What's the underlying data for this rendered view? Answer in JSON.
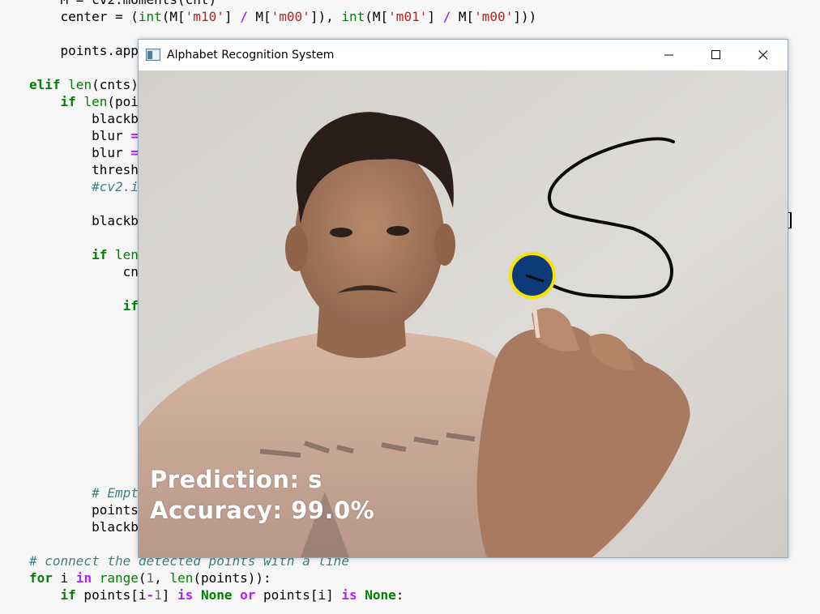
{
  "code_lines": [
    {
      "indent": "    ",
      "parts": [
        {
          "t": "M = cv2.moments(cnt)",
          "c": ""
        }
      ]
    },
    {
      "indent": "    ",
      "parts": [
        {
          "t": "center = (",
          "c": ""
        },
        {
          "t": "int",
          "c": "bi"
        },
        {
          "t": "(M[",
          "c": ""
        },
        {
          "t": "'m10'",
          "c": "str"
        },
        {
          "t": "] ",
          "c": ""
        },
        {
          "t": "/",
          "c": "op"
        },
        {
          "t": " M[",
          "c": ""
        },
        {
          "t": "'m00'",
          "c": "str"
        },
        {
          "t": "]), ",
          "c": ""
        },
        {
          "t": "int",
          "c": "bi"
        },
        {
          "t": "(M[",
          "c": ""
        },
        {
          "t": "'m01'",
          "c": "str"
        },
        {
          "t": "] ",
          "c": ""
        },
        {
          "t": "/",
          "c": "op"
        },
        {
          "t": " M[",
          "c": ""
        },
        {
          "t": "'m00'",
          "c": "str"
        },
        {
          "t": "]))",
          "c": ""
        }
      ]
    },
    {
      "indent": "",
      "parts": []
    },
    {
      "indent": "    ",
      "parts": [
        {
          "t": "points.app",
          "c": ""
        }
      ]
    },
    {
      "indent": "",
      "parts": []
    },
    {
      "indent": "",
      "parts": [
        {
          "t": "elif",
          "c": "kw"
        },
        {
          "t": " ",
          "c": ""
        },
        {
          "t": "len",
          "c": "bi"
        },
        {
          "t": "(cnts)",
          "c": ""
        }
      ]
    },
    {
      "indent": "    ",
      "parts": [
        {
          "t": "if",
          "c": "kw"
        },
        {
          "t": " ",
          "c": ""
        },
        {
          "t": "len",
          "c": "bi"
        },
        {
          "t": "(poi",
          "c": ""
        }
      ]
    },
    {
      "indent": "        ",
      "parts": [
        {
          "t": "blackb",
          "c": ""
        }
      ]
    },
    {
      "indent": "        ",
      "parts": [
        {
          "t": "blur ",
          "c": ""
        },
        {
          "t": "=",
          "c": "op"
        }
      ]
    },
    {
      "indent": "        ",
      "parts": [
        {
          "t": "blur ",
          "c": ""
        },
        {
          "t": "=",
          "c": "op"
        }
      ]
    },
    {
      "indent": "        ",
      "parts": [
        {
          "t": "thresh",
          "c": ""
        }
      ]
    },
    {
      "indent": "        ",
      "parts": [
        {
          "t": "#cv2.i",
          "c": "cm"
        }
      ]
    },
    {
      "indent": "",
      "parts": []
    },
    {
      "indent": "        ",
      "parts": [
        {
          "t": "blackb",
          "c": ""
        }
      ]
    },
    {
      "indent": "",
      "parts": []
    },
    {
      "indent": "        ",
      "parts": [
        {
          "t": "if",
          "c": "kw"
        },
        {
          "t": " len",
          "c": "bi"
        }
      ]
    },
    {
      "indent": "            ",
      "parts": [
        {
          "t": "cn",
          "c": ""
        }
      ]
    },
    {
      "indent": "",
      "parts": []
    },
    {
      "indent": "            ",
      "parts": [
        {
          "t": "if",
          "c": "kw"
        }
      ]
    },
    {
      "indent": "",
      "parts": []
    },
    {
      "indent": "",
      "parts": []
    },
    {
      "indent": "",
      "parts": []
    },
    {
      "indent": "",
      "parts": []
    },
    {
      "indent": "",
      "parts": []
    },
    {
      "indent": "",
      "parts": []
    },
    {
      "indent": "",
      "parts": []
    },
    {
      "indent": "",
      "parts": []
    },
    {
      "indent": "",
      "parts": []
    },
    {
      "indent": "",
      "parts": []
    },
    {
      "indent": "        ",
      "parts": [
        {
          "t": "# Empt",
          "c": "cm"
        }
      ]
    },
    {
      "indent": "        ",
      "parts": [
        {
          "t": "points",
          "c": ""
        }
      ]
    },
    {
      "indent": "        ",
      "parts": [
        {
          "t": "blackb",
          "c": ""
        }
      ]
    },
    {
      "indent": "",
      "parts": []
    },
    {
      "indent": "",
      "parts": [
        {
          "t": "# connect the detected points with a line",
          "c": "cm"
        }
      ]
    },
    {
      "indent": "",
      "parts": [
        {
          "t": "for",
          "c": "kw"
        },
        {
          "t": " i ",
          "c": ""
        },
        {
          "t": "in",
          "c": "op"
        },
        {
          "t": " ",
          "c": ""
        },
        {
          "t": "range",
          "c": "bi"
        },
        {
          "t": "(",
          "c": ""
        },
        {
          "t": "1",
          "c": "num"
        },
        {
          "t": ", ",
          "c": ""
        },
        {
          "t": "len",
          "c": "bi"
        },
        {
          "t": "(points)):",
          "c": ""
        }
      ]
    },
    {
      "indent": "    ",
      "parts": [
        {
          "t": "if",
          "c": "kw"
        },
        {
          "t": " points[i",
          "c": ""
        },
        {
          "t": "-",
          "c": "op"
        },
        {
          "t": "1",
          "c": "num"
        },
        {
          "t": "] ",
          "c": ""
        },
        {
          "t": "is",
          "c": "op"
        },
        {
          "t": " ",
          "c": ""
        },
        {
          "t": "None",
          "c": "kw"
        },
        {
          "t": " ",
          "c": ""
        },
        {
          "t": "or",
          "c": "op"
        },
        {
          "t": " points[i] ",
          "c": ""
        },
        {
          "t": "is",
          "c": "op"
        },
        {
          "t": " ",
          "c": ""
        },
        {
          "t": "None",
          "c": "kw"
        },
        {
          "t": ":",
          "c": ""
        }
      ]
    }
  ],
  "window": {
    "title": "Alphabet Recognition System",
    "minimize_symbol": "—",
    "close_symbol": "✕"
  },
  "overlay": {
    "prediction": "Prediction: s",
    "accuracy": "Accuracy: 99.0%"
  },
  "colors": {
    "editor_bg": "#f7f7f7",
    "keyword": "#008000",
    "string": "#ba2121",
    "operator": "#aa22ff",
    "comment": "#408080",
    "tracker_fill": "#0d3b7a",
    "tracker_ring": "#f5e400"
  },
  "icons": [
    "app-window-icon",
    "minimize-icon",
    "maximize-icon",
    "close-icon"
  ]
}
